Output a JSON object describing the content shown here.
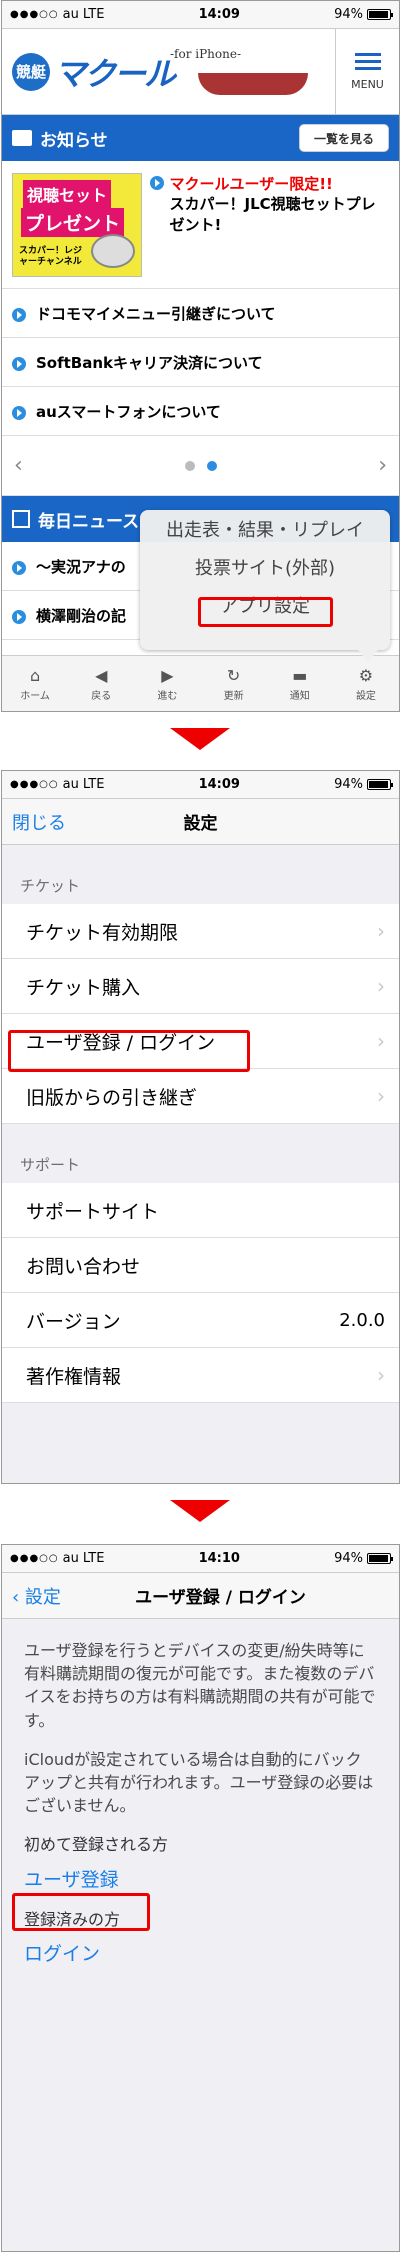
{
  "status_bars": [
    {
      "carrier": "au",
      "network": "LTE",
      "time": "14:09",
      "battery": "94%"
    },
    {
      "carrier": "au",
      "network": "LTE",
      "time": "14:09",
      "battery": "94%"
    },
    {
      "carrier": "au",
      "network": "LTE",
      "time": "14:10",
      "battery": "94%"
    }
  ],
  "screen1": {
    "logo_badge": "競艇",
    "logo_text": "マクール",
    "logo_sub": "-for iPhone-",
    "menu_label": "MENU",
    "notice_title": "お知らせ",
    "list_button": "一覧を見る",
    "promo_img": {
      "line1": "視聴セット",
      "line2": "プレゼント",
      "line3": "スカパー！レジャーチャンネル"
    },
    "promo_red": "マクールユーザー限定!!",
    "promo_text": "スカパー！JLC視聴セットプレゼント!",
    "news": [
      "ドコモマイメニュー引継ぎについて",
      "SoftBankキャリア決済について",
      "auスマートフォンについて"
    ],
    "daily_title": "毎日ニュース",
    "daily_items": [
      "〜実況アナの",
      "横澤剛治の記"
    ],
    "popup": [
      "出走表・結果・リプレイ",
      "投票サイト(外部)",
      "アプリ設定"
    ],
    "toolbar": [
      {
        "label": "ホーム",
        "icon": "home-icon",
        "glyph": "⌂"
      },
      {
        "label": "戻る",
        "icon": "back-icon",
        "glyph": "◀"
      },
      {
        "label": "進む",
        "icon": "forward-icon",
        "glyph": "▶"
      },
      {
        "label": "更新",
        "icon": "refresh-icon",
        "glyph": "↻"
      },
      {
        "label": "通知",
        "icon": "notify-icon",
        "glyph": "▬"
      },
      {
        "label": "設定",
        "icon": "gear-icon",
        "glyph": "⚙"
      }
    ]
  },
  "screen2": {
    "close_label": "閉じる",
    "title": "設定",
    "ticket_header": "チケット",
    "ticket_items": [
      "チケット有効期限",
      "チケット購入",
      "ユーザ登録 / ログイン",
      "旧版からの引き継ぎ"
    ],
    "support_header": "サポート",
    "support_items": [
      "サポートサイト",
      "お問い合わせ",
      "バージョン",
      "著作権情報"
    ],
    "version_value": "2.0.0"
  },
  "screen3": {
    "back_label": "設定",
    "title": "ユーザ登録 / ログイン",
    "para1": "ユーザ登録を行うとデバイスの変更/紛失時等に有料購読期間の復元が可能です。また複数のデバイスをお持ちの方は有料購読期間の共有が可能です。",
    "para2": "iCloudが設定されている場合は自動的にバックアップと共有が行われます。ユーザ登録の必要はございません。",
    "first_label": "初めて登録される方",
    "register_link": "ユーザ登録",
    "existing_label": "登録済みの方",
    "login_link": "ログイン"
  },
  "colors": {
    "accent": "#1a66c6",
    "highlight": "#e00000",
    "link": "#1a7ee6"
  }
}
